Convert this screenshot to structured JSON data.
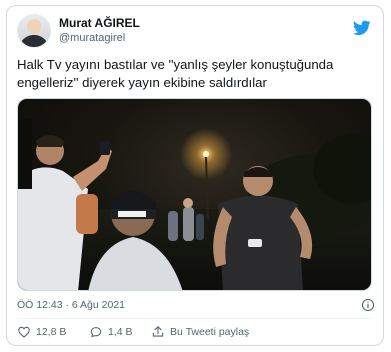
{
  "tweet": {
    "author": {
      "display_name": "Murat AĞIREL",
      "handle": "@muratagirel"
    },
    "text": "Halk Tv yayını bastılar ve ''yanlış şeyler konuştuğunda engelleriz'' diyerek yayın ekibine saldırdılar",
    "timestamp": "ÖÖ 12:43 · 6 Ağu 2021",
    "likes": "12,8 B",
    "replies": "1,4 B",
    "share_label": "Bu Tweeti paylaş"
  },
  "media": {
    "type": "video-frame",
    "description_visible": false
  },
  "icons": {
    "brand": "twitter-bird-icon",
    "info": "info-icon",
    "like": "heart-icon",
    "reply": "reply-bubble-icon",
    "share": "share-icon"
  },
  "colors": {
    "brand_blue": "#1d9bf0",
    "secondary_text": "#536471",
    "border": "#cfd9de"
  }
}
